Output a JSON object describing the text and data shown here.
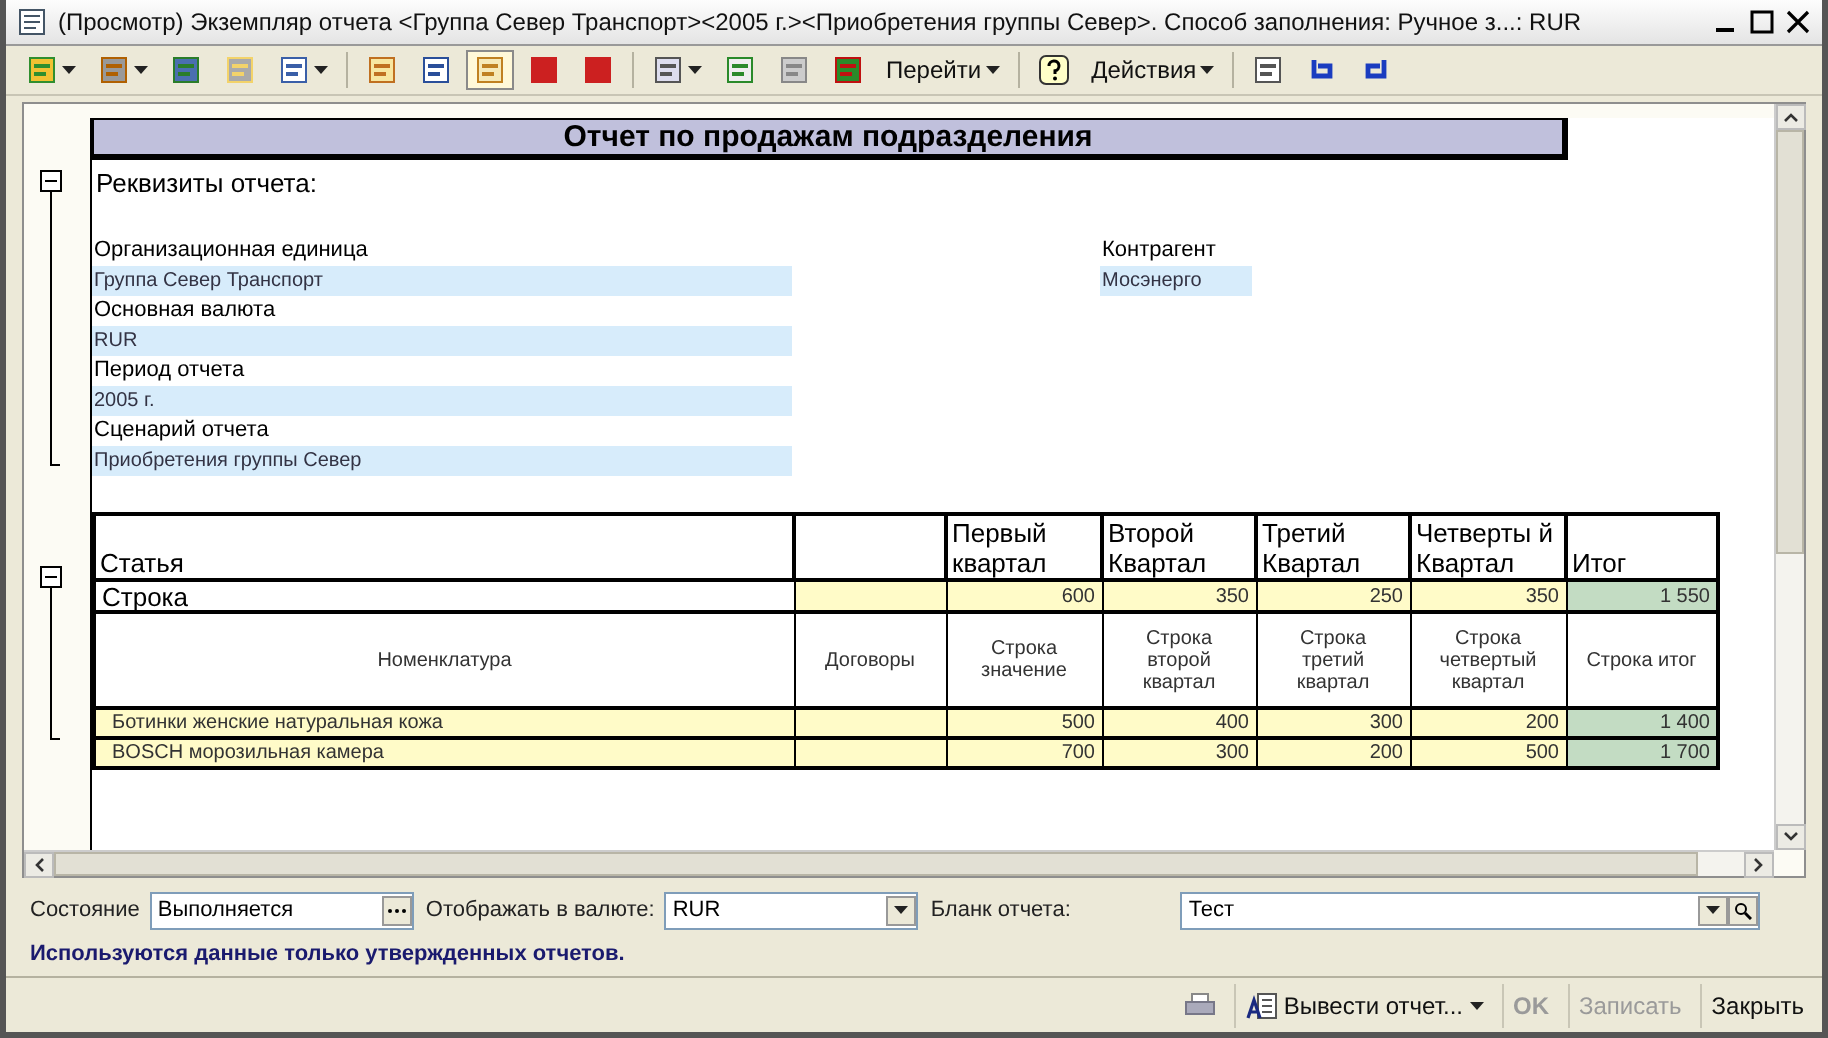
{
  "window": {
    "title": "(Просмотр) Экземпляр отчета <Группа Север Транспорт><2005 г.><Приобретения группы Север>. Способ заполнения: Ручное з...: RUR"
  },
  "toolbar": {
    "menus": [
      {
        "label": "Перейти"
      },
      {
        "label": "Действия"
      }
    ]
  },
  "report": {
    "title": "Отчет по продажам подразделения",
    "section": {
      "label": "Реквизиты отчета:",
      "expanded": true
    },
    "fields": [
      {
        "label": "Организационная единица",
        "value": "Группа Север Транспорт"
      },
      {
        "label": "Основная валюта",
        "value": "RUR"
      },
      {
        "label": "Период отчета",
        "value": "2005 г."
      },
      {
        "label": "Сценарий отчета",
        "value": "Приобретения группы Север"
      }
    ],
    "counterparty": {
      "label": "Контрагент",
      "value": "Мосэнерго"
    },
    "table": {
      "columns": [
        "Статья",
        "",
        "Первый квартал",
        "Второй Квартал",
        "Третий Квартал",
        "Четверты й Квартал",
        "Итог"
      ],
      "group": {
        "label": "Строка",
        "expanded": true,
        "cells": [
          "",
          "600",
          "350",
          "250",
          "350",
          "1 550"
        ]
      },
      "subheader": [
        "Номенклатура",
        "Договоры",
        "Строка значение",
        "Строка второй квартал",
        "Строка третий квартал",
        "Строка четвертый квартал",
        "Строка итог"
      ],
      "rows": [
        {
          "cells": [
            "Ботинки женские натуральная кожа",
            "",
            "500",
            "400",
            "300",
            "200",
            "1 400"
          ]
        },
        {
          "cells": [
            "BOSCH морозильная камера",
            "",
            "700",
            "300",
            "200",
            "500",
            "1 700"
          ]
        }
      ]
    }
  },
  "filters": [
    {
      "label": "Состояние",
      "value": "Выполняется",
      "kind": "choice"
    },
    {
      "label": "Отображать в валюте:",
      "value": "RUR",
      "kind": "dropdown"
    },
    {
      "label": "Бланк отчета:",
      "value": "Тест",
      "kind": "search"
    }
  ],
  "note": "Используются данные только утвержденных отчетов.",
  "footer": {
    "buttons": [
      {
        "label": "Вывести отчет...",
        "kind": "menu",
        "disabled": false
      },
      {
        "label": "OK",
        "kind": "default",
        "disabled": true
      },
      {
        "label": "Записать",
        "kind": "plain",
        "disabled": true
      },
      {
        "label": "Закрыть",
        "kind": "plain",
        "disabled": false
      }
    ]
  }
}
